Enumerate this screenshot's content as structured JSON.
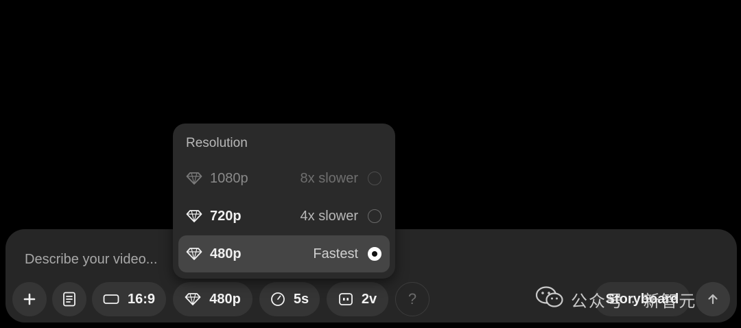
{
  "composer": {
    "prompt_placeholder": "Describe your video..."
  },
  "toolbar": {
    "add_icon": "plus-icon",
    "storyboard_icon": "document-icon",
    "aspect_ratio": {
      "icon": "rectangle-icon",
      "label": "16:9"
    },
    "resolution": {
      "icon": "diamond-icon",
      "label": "480p"
    },
    "duration": {
      "icon": "clock-icon",
      "label": "5s"
    },
    "variations": {
      "icon": "video-grid-icon",
      "label": "2v"
    },
    "help_label": "?",
    "storyboard_label": "Storyboard",
    "submit_icon": "arrow-up-icon"
  },
  "resolution_menu": {
    "title": "Resolution",
    "options": [
      {
        "label": "1080p",
        "speed": "8x slower",
        "state": "disabled",
        "icon": "diamond-icon"
      },
      {
        "label": "720p",
        "speed": "4x slower",
        "state": "available",
        "icon": "diamond-icon"
      },
      {
        "label": "480p",
        "speed": "Fastest",
        "state": "selected",
        "icon": "diamond-icon"
      }
    ]
  },
  "watermark": {
    "icon": "wechat-icon",
    "text": "公众号 · 新智元"
  },
  "colors": {
    "background": "#000000",
    "panel": "#262626",
    "pill": "#353535",
    "popup": "#2a2a2a",
    "selected_row": "#454545"
  }
}
